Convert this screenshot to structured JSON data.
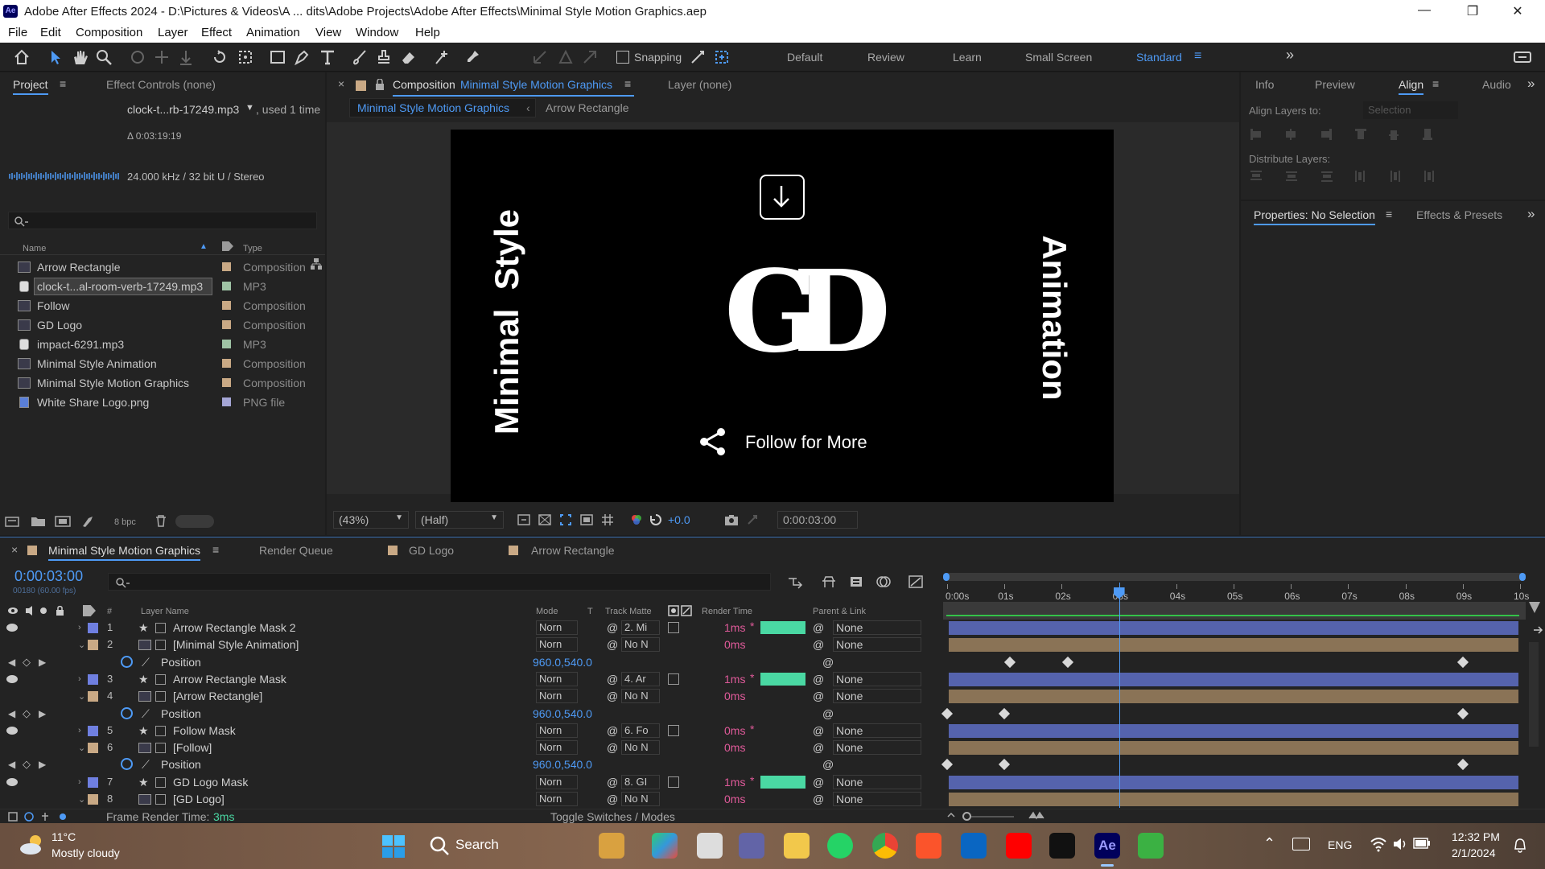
{
  "window": {
    "title": "Adobe After Effects 2024 - D:\\Pictures & Videos\\A ... dits\\Adobe Projects\\Adobe After Effects\\Minimal Style Motion Graphics.aep",
    "app_icon_label": "Ae",
    "controls": [
      "—",
      "❐",
      "✕"
    ]
  },
  "menu": [
    "File",
    "Edit",
    "Composition",
    "Layer",
    "Effect",
    "Animation",
    "View",
    "Window",
    "Help"
  ],
  "toolbar": {
    "snapping_label": "Snapping",
    "workspaces": [
      "Default",
      "Review",
      "Learn",
      "Small Screen",
      "Standard"
    ],
    "active_workspace": "Standard",
    "more": "»"
  },
  "project_panel": {
    "tabs": [
      "Project",
      "Effect Controls (none)"
    ],
    "selected_file": "clock-t...rb-17249.mp3",
    "used": ", used 1 time",
    "duration": "Δ 0:03:19:19",
    "audio_info": "24.000 kHz / 32 bit U / Stereo",
    "search_placeholder": "",
    "col_name": "Name",
    "col_type": "Type",
    "items": [
      {
        "name": "Arrow Rectangle",
        "type": "Composition",
        "label_color": "#c9a985",
        "icon": "composition-icon"
      },
      {
        "name": "clock-t...al-room-verb-17249.mp3",
        "type": "MP3",
        "label_color": "#9fc3a5",
        "icon": "audio-file-icon",
        "selected": true
      },
      {
        "name": "Follow",
        "type": "Composition",
        "label_color": "#c9a985",
        "icon": "composition-icon"
      },
      {
        "name": "GD Logo",
        "type": "Composition",
        "label_color": "#c9a985",
        "icon": "composition-icon"
      },
      {
        "name": "impact-6291.mp3",
        "type": "MP3",
        "label_color": "#9fc3a5",
        "icon": "audio-file-icon"
      },
      {
        "name": "Minimal Style Animation",
        "type": "Composition",
        "label_color": "#c9a985",
        "icon": "composition-icon"
      },
      {
        "name": "Minimal Style Motion Graphics",
        "type": "Composition",
        "label_color": "#c9a985",
        "icon": "composition-icon"
      },
      {
        "name": "White Share Logo.png",
        "type": "PNG file",
        "label_color": "#a5a6d6",
        "icon": "image-file-icon"
      }
    ],
    "bpc": "8 bpc"
  },
  "composition_panel": {
    "tab_prefix": "Composition",
    "tab_name": "Minimal Style Motion Graphics",
    "layer_tab": "Layer  (none)",
    "breadcrumbs": [
      "Minimal Style Motion Graphics",
      "Arrow Rectangle"
    ],
    "canvas": {
      "left_text": "Minimal  Style",
      "right_text": "Animation",
      "logo_text": "GD",
      "follow_text": "Follow for More"
    },
    "zoom": "(43%)",
    "resolution": "(Half)",
    "exposure": "+0.0",
    "timecode": "0:00:03:00"
  },
  "right_panels": {
    "tabs": [
      "Info",
      "Preview",
      "Align",
      "Audio"
    ],
    "active_tab": "Align",
    "align_layers_to": "Align Layers to:",
    "align_target": "Selection",
    "distribute_layers": "Distribute Layers:",
    "properties_tab": "Properties: No Selection",
    "effects_tab": "Effects & Presets"
  },
  "timeline": {
    "tabs": [
      "Minimal Style Motion Graphics",
      "Render Queue",
      "GD Logo",
      "Arrow Rectangle"
    ],
    "tab_label_colors": [
      "#c9a985",
      "",
      "#c9a985",
      "#c9a985"
    ],
    "current_time": "0:00:03:00",
    "frame_info": "00180 (60.00 fps)",
    "columns": {
      "layer_name": "Layer Name",
      "mode": "Mode",
      "t": "T",
      "track_matte": "Track Matte",
      "render_time": "Render Time",
      "parent": "Parent & Link"
    },
    "ruler": [
      "0:00s",
      "01s",
      "02s",
      "03s",
      "04s",
      "05s",
      "06s",
      "07s",
      "08s",
      "09s",
      "10s"
    ],
    "playhead_seconds": 3,
    "duration_seconds": 10,
    "rows": [
      {
        "kind": "layer",
        "num": "1",
        "name": "Arrow Rectangle Mask 2",
        "label_color": "#6f7fe0",
        "shape": true,
        "mode": "Norn",
        "matte": "2. Mi",
        "render": "1ms",
        "render_bar": true,
        "parent": "None",
        "bar_color": "#5563ad",
        "visible": true
      },
      {
        "kind": "layer",
        "num": "2",
        "name": "[Minimal Style Animation]",
        "label_color": "#c9a985",
        "shape": false,
        "mode": "Norn",
        "matte": "No N",
        "render": "0ms",
        "render_bar": false,
        "parent": "None",
        "bar_color": "#8a7356",
        "visible": false
      },
      {
        "kind": "prop",
        "name": "Position",
        "value": "960.0,540.0",
        "keys": [
          1.1,
          2.1,
          9.0
        ]
      },
      {
        "kind": "layer",
        "num": "3",
        "name": "Arrow Rectangle Mask",
        "label_color": "#6f7fe0",
        "shape": true,
        "mode": "Norn",
        "matte": "4. Ar",
        "render": "1ms",
        "render_bar": true,
        "parent": "None",
        "bar_color": "#5563ad",
        "visible": true
      },
      {
        "kind": "layer",
        "num": "4",
        "name": "[Arrow Rectangle]",
        "label_color": "#c9a985",
        "shape": false,
        "mode": "Norn",
        "matte": "No N",
        "render": "0ms",
        "render_bar": false,
        "parent": "None",
        "bar_color": "#8a7356",
        "visible": false
      },
      {
        "kind": "prop",
        "name": "Position",
        "value": "960.0,540.0",
        "keys": [
          0.0,
          1.0,
          9.0
        ]
      },
      {
        "kind": "layer",
        "num": "5",
        "name": "Follow Mask",
        "label_color": "#6f7fe0",
        "shape": true,
        "mode": "Norn",
        "matte": "6. Fo",
        "render": "0ms",
        "render_bar": false,
        "parent": "None",
        "bar_color": "#5563ad",
        "visible": true
      },
      {
        "kind": "layer",
        "num": "6",
        "name": "[Follow]",
        "label_color": "#c9a985",
        "shape": false,
        "mode": "Norn",
        "matte": "No N",
        "render": "0ms",
        "render_bar": false,
        "parent": "None",
        "bar_color": "#8a7356",
        "visible": false
      },
      {
        "kind": "prop",
        "name": "Position",
        "value": "960.0,540.0",
        "keys": [
          0.0,
          1.0,
          9.0
        ]
      },
      {
        "kind": "layer",
        "num": "7",
        "name": "GD Logo Mask",
        "label_color": "#6f7fe0",
        "shape": true,
        "mode": "Norn",
        "matte": "8. GI",
        "render": "1ms",
        "render_bar": true,
        "parent": "None",
        "bar_color": "#5563ad",
        "visible": true
      },
      {
        "kind": "layer",
        "num": "8",
        "name": "[GD Logo]",
        "label_color": "#c9a985",
        "shape": false,
        "mode": "Norn",
        "matte": "No N",
        "render": "0ms",
        "render_bar": false,
        "parent": "None",
        "bar_color": "#8a7356",
        "visible": false
      }
    ],
    "frame_render_label": "Frame Render Time:",
    "frame_render_value": "3ms",
    "toggle_label": "Toggle Switches / Modes"
  },
  "taskbar": {
    "weather_temp": "11°C",
    "weather_desc": "Mostly cloudy",
    "search_label": "Search",
    "apps": [
      "file-explorer-icon",
      "premiere-icon",
      "task-view-icon",
      "teams-icon",
      "folder-icon",
      "whatsapp-icon",
      "chrome-icon",
      "brave-icon",
      "linkedin-icon",
      "youtube-icon",
      "github-icon",
      "after-effects-icon",
      "pixelmator-icon"
    ],
    "lang": "ENG",
    "time": "12:32 PM",
    "date": "2/1/2024"
  },
  "colors": {
    "accent_blue": "#4e9af5",
    "panel_bg": "#232323",
    "render_bar": "#4ad8a3"
  }
}
